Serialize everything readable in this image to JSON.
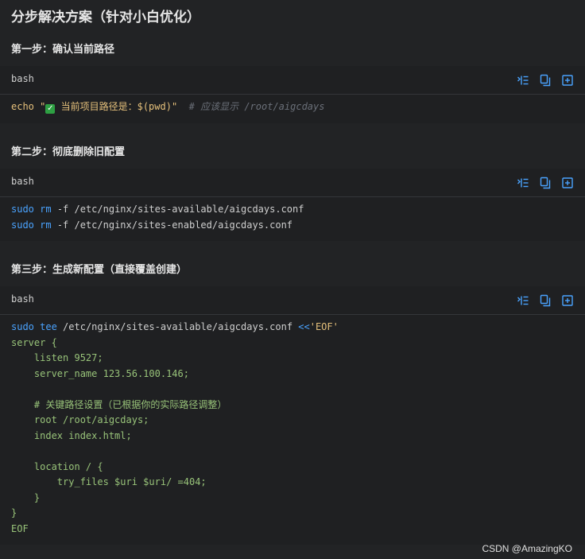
{
  "title": "分步解决方案（针对小白优化）",
  "steps": [
    {
      "title": "第一步：确认当前路径",
      "lang": "bash",
      "lines": [
        [
          {
            "t": "echo",
            "c": "str"
          },
          {
            "t": " ",
            "c": ""
          },
          {
            "t": "\"",
            "c": "str"
          },
          {
            "t": "✓",
            "c": "check"
          },
          {
            "t": " 当前项目路径是：",
            "c": "str"
          },
          {
            "t": "$(pwd)",
            "c": "str"
          },
          {
            "t": "\"",
            "c": "str"
          },
          {
            "t": "  # 应该显示 /root/aigcdays",
            "c": "com"
          }
        ]
      ]
    },
    {
      "title": "第二步：彻底删除旧配置",
      "lang": "bash",
      "lines": [
        [
          {
            "t": "sudo",
            "c": "kw"
          },
          {
            "t": " ",
            "c": ""
          },
          {
            "t": "rm",
            "c": "kw"
          },
          {
            "t": " -f /etc/nginx/sites-available/aigcdays.conf",
            "c": ""
          }
        ],
        [
          {
            "t": "sudo",
            "c": "kw"
          },
          {
            "t": " ",
            "c": ""
          },
          {
            "t": "rm",
            "c": "kw"
          },
          {
            "t": " -f /etc/nginx/sites-enabled/aigcdays.conf",
            "c": ""
          }
        ]
      ]
    },
    {
      "title": "第三步：生成新配置（直接覆盖创建）",
      "lang": "bash",
      "lines": [
        [
          {
            "t": "sudo",
            "c": "kw"
          },
          {
            "t": " ",
            "c": ""
          },
          {
            "t": "tee",
            "c": "kw"
          },
          {
            "t": " /etc/nginx/sites-available/aigcdays.conf ",
            "c": ""
          },
          {
            "t": "<<",
            "c": "kw"
          },
          {
            "t": "'EOF'",
            "c": "str"
          }
        ],
        [
          {
            "t": "server {",
            "c": "grn"
          }
        ],
        [
          {
            "t": "    listen 9527;",
            "c": "grn"
          }
        ],
        [
          {
            "t": "    server_name 123.56.100.146;",
            "c": "grn"
          }
        ],
        [
          {
            "t": "",
            "c": ""
          }
        ],
        [
          {
            "t": "    # 关键路径设置（已根据你的实际路径调整）",
            "c": "grn"
          }
        ],
        [
          {
            "t": "    root /root/aigcdays;",
            "c": "grn"
          }
        ],
        [
          {
            "t": "    index index.html;",
            "c": "grn"
          }
        ],
        [
          {
            "t": "",
            "c": ""
          }
        ],
        [
          {
            "t": "    location / {",
            "c": "grn"
          }
        ],
        [
          {
            "t": "        try_files $uri $uri/ =404;",
            "c": "grn"
          }
        ],
        [
          {
            "t": "    }",
            "c": "grn"
          }
        ],
        [
          {
            "t": "}",
            "c": "grn"
          }
        ],
        [
          {
            "t": "EOF",
            "c": "grn"
          }
        ]
      ]
    }
  ],
  "icons": [
    "wrap-lines-icon",
    "copy-icon",
    "expand-icon"
  ],
  "colors": {
    "background": "#222325",
    "icon_blue": "#4aa3ff",
    "keyword": "#4aa3ff",
    "string": "#e5c07b",
    "heredoc": "#98c379",
    "comment": "#6a6f78"
  },
  "watermark": "CSDN @AmazingKO"
}
